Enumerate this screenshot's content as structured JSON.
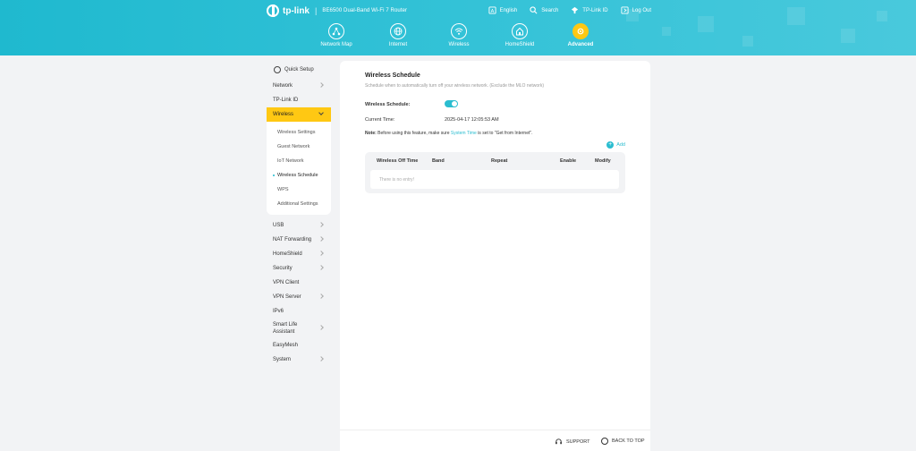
{
  "header": {
    "brand": "tp-link",
    "model": "BE6500 Dual-Band Wi-Fi 7 Router",
    "links": [
      {
        "label": "English",
        "icon": "globe-icon"
      },
      {
        "label": "Search",
        "icon": "search-icon"
      },
      {
        "label": "TP-Link ID",
        "icon": "user-icon"
      },
      {
        "label": "Log Out",
        "icon": "logout-icon"
      }
    ],
    "nav": [
      {
        "label": "Network Map",
        "icon": "network-map-icon",
        "active": false
      },
      {
        "label": "Internet",
        "icon": "globe-icon",
        "active": false
      },
      {
        "label": "Wireless",
        "icon": "wifi-icon",
        "active": false
      },
      {
        "label": "HomeShield",
        "icon": "home-shield-icon",
        "active": false
      },
      {
        "label": "Advanced",
        "icon": "gear-icon",
        "active": true
      }
    ]
  },
  "sidebar": {
    "quick_setup": "Quick Setup",
    "items_top": [
      {
        "label": "Network",
        "chevron": true
      },
      {
        "label": "TP-Link ID",
        "chevron": false
      }
    ],
    "active_section": "Wireless",
    "submenu": [
      {
        "label": "Wireless Settings"
      },
      {
        "label": "Guest Network"
      },
      {
        "label": "IoT Network"
      },
      {
        "label": "Wireless Schedule",
        "current": true
      },
      {
        "label": "WPS"
      },
      {
        "label": "Additional Settings"
      }
    ],
    "items_bottom": [
      {
        "label": "USB",
        "chevron": true
      },
      {
        "label": "NAT Forwarding",
        "chevron": true
      },
      {
        "label": "HomeShield",
        "chevron": true
      },
      {
        "label": "Security",
        "chevron": true
      },
      {
        "label": "VPN Client",
        "chevron": false
      },
      {
        "label": "VPN Server",
        "chevron": true
      },
      {
        "label": "IPv6",
        "chevron": false
      },
      {
        "label": "Smart Life Assistant",
        "chevron": true,
        "two_line": true
      },
      {
        "label": "EasyMesh",
        "chevron": false
      },
      {
        "label": "System",
        "chevron": true
      }
    ]
  },
  "content": {
    "title": "Wireless Schedule",
    "description": "Schedule when to automatically turn off your wireless network. (Exclude the MLO network)",
    "schedule_label": "Wireless Schedule:",
    "schedule_enabled": true,
    "current_time_label": "Current Time:",
    "current_time_value": "2025-04-17 12:05:53 AM",
    "note_prefix": "Note:",
    "note_text_1": "Before using this feature, make sure",
    "note_link": "System Time",
    "note_text_2": "is set to \"Get from Internet\".",
    "add_label": "Add",
    "table": {
      "columns": [
        "Wireless Off Time",
        "Band",
        "Repeat",
        "Enable",
        "Modify"
      ],
      "empty_text": "There is no entry!"
    }
  },
  "footer": {
    "support": "SUPPORT",
    "back_to_top": "BACK TO TOP"
  },
  "colors": {
    "header_bg": "#33c2d7",
    "accent": "#2bbdd0",
    "active_yellow": "#ffc813"
  }
}
